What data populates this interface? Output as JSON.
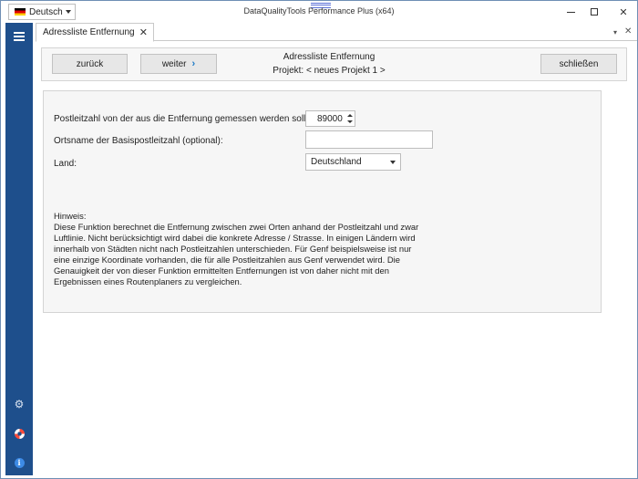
{
  "titlebar": {
    "language": "Deutsch",
    "app_title": "DataQualityTools Performance Plus (x64)",
    "close_glyph": "✕"
  },
  "tab": {
    "label": "Adressliste Entfernung",
    "close_glyph": "✕",
    "strip_menu_glyph": "▾",
    "strip_close_glyph": "✕"
  },
  "header": {
    "back_label": "zurück",
    "next_label": "weiter",
    "next_chevron": "›",
    "title": "Adressliste Entfernung",
    "project": "Projekt: < neues Projekt 1 >",
    "close_label": "schließen"
  },
  "form": {
    "plz_label": "Postleitzahl von der aus die Entfernung gemessen werden soll:",
    "plz_value": "89000",
    "ort_label": "Ortsname der Basispostleitzahl (optional):",
    "ort_value": "",
    "land_label": "Land:",
    "land_value": "Deutschland"
  },
  "hint": {
    "heading": "Hinweis:",
    "lines": [
      "Diese Funktion berechnet die Entfernung zwischen zwei Orten anhand der Postleitzahl und zwar",
      "Luftlinie. Nicht berücksichtigt wird dabei die konkrete Adresse / Strasse. In einigen Ländern wird",
      "innerhalb von Städten nicht nach Postleitzahlen unterschieden. Für Genf beispielsweise ist nur",
      "eine einzige Koordinate vorhanden, die für alle Postleitzahlen aus Genf verwendet wird. Die",
      "Genauigkeit der von dieser Funktion ermittelten Entfernungen ist von daher nicht mit den",
      "Ergebnissen eines Routenplaners zu vergleichen."
    ]
  },
  "sidebar": {
    "menu_icon": "hamburger-icon",
    "settings_icon": "gear-icon",
    "settings_glyph": "⚙",
    "help_icon": "lifebuoy-icon",
    "info_icon": "info-icon",
    "info_glyph": "i"
  },
  "colors": {
    "sidebar": "#1e4f8c",
    "accent": "#1c7ac7",
    "panel": "#f6f6f6"
  }
}
